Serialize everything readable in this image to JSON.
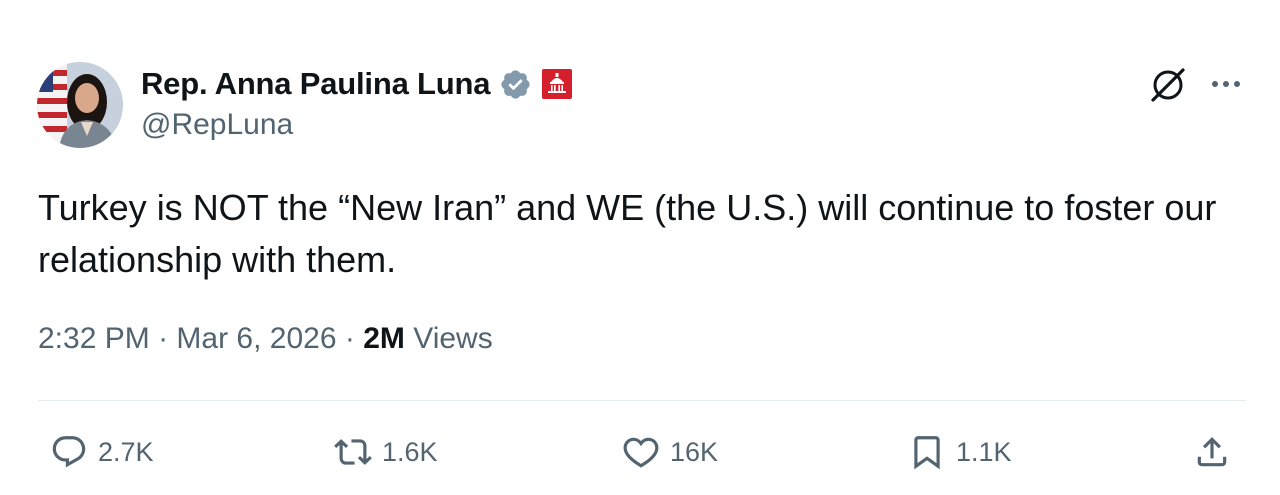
{
  "author": {
    "name": "Rep. Anna Paulina Luna",
    "handle": "@RepLuna"
  },
  "tweet": {
    "text": "Turkey is NOT the “New Iran” and WE (the U.S.) will continue to foster our relationship with them.",
    "time": "2:32 PM",
    "date": "Mar 6, 2026",
    "views_count": "2M",
    "views_label": "Views",
    "separator": "·"
  },
  "actions": {
    "replies": "2.7K",
    "reposts": "1.6K",
    "likes": "16K",
    "bookmarks": "1.1K"
  },
  "colors": {
    "verified_badge": "#829aab",
    "gov_badge": "#d4202c",
    "secondary_text": "#536471",
    "primary_text": "#0f1419"
  },
  "icons": {
    "verified": "verified-badge-icon",
    "government": "capitol-icon",
    "grok": "grok-icon",
    "more": "more-icon",
    "reply": "reply-icon",
    "repost": "repost-icon",
    "like": "heart-icon",
    "bookmark": "bookmark-icon",
    "share": "share-icon"
  }
}
